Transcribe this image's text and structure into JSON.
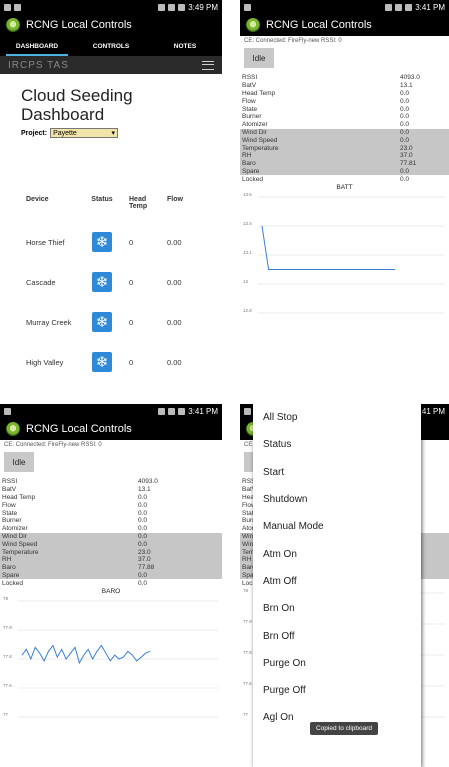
{
  "app": {
    "name": "RCNG Local Controls"
  },
  "screen1": {
    "status_time": "3:49 PM",
    "tabs": [
      {
        "label": "DASHBOARD"
      },
      {
        "label": "CONTROLS"
      },
      {
        "label": "NOTES"
      }
    ],
    "site_logo": "IRCPS TAS",
    "title_line1": "Cloud Seeding",
    "title_line2": "Dashboard",
    "project_label": "Project:",
    "project_value": "Payette",
    "columns": [
      "Device",
      "Status",
      "Head Temp",
      "Flow"
    ],
    "devices": [
      {
        "name": "Horse Thief",
        "head_temp": "0",
        "flow": "0.00"
      },
      {
        "name": "Cascade",
        "head_temp": "0",
        "flow": "0.00"
      },
      {
        "name": "Murray Creek",
        "head_temp": "0",
        "flow": "0.00"
      },
      {
        "name": "High Valley",
        "head_temp": "0",
        "flow": "0.00"
      }
    ],
    "status_icon": "snowflake-icon"
  },
  "controls": {
    "status_time": "3:41 PM",
    "connection": "CE: Connected: FireFly-new RSSI: 0",
    "idle_label": "Idle",
    "readings": [
      {
        "label": "RSSI",
        "value": "4093.0",
        "shaded": false
      },
      {
        "label": "BatV",
        "value": "13.1",
        "shaded": false
      },
      {
        "label": "Head Temp",
        "value": "0.0",
        "shaded": false
      },
      {
        "label": "Flow",
        "value": "0.0",
        "shaded": false
      },
      {
        "label": "State",
        "value": "0.0",
        "shaded": false
      },
      {
        "label": "Burner",
        "value": "0.0",
        "shaded": false
      },
      {
        "label": "Atomizer",
        "value": "0.0",
        "shaded": false
      },
      {
        "label": "Wind Dir",
        "value": "0.0",
        "shaded": true
      },
      {
        "label": "Wind Speed",
        "value": "0.0",
        "shaded": true
      },
      {
        "label": "Temperature",
        "value": "23.0",
        "shaded": true
      },
      {
        "label": "RH",
        "value": "37.0",
        "shaded": true
      },
      {
        "label": "Baro",
        "value": "77.81",
        "shaded": true
      },
      {
        "label": "Spare",
        "value": "0.0",
        "shaded": true
      },
      {
        "label": "Locked",
        "value": "0.0",
        "shaded": false
      }
    ],
    "baro_alt": "77.88"
  },
  "menu": {
    "items": [
      "All Stop",
      "Status",
      "Start",
      "Shutdown",
      "Manual Mode",
      "Atm On",
      "Atm Off",
      "Brn On",
      "Brn Off",
      "Purge On",
      "Purge Off",
      "Agl On"
    ],
    "toast": "Copied to clipboard"
  },
  "chart_data": [
    {
      "type": "line",
      "title": "BATT",
      "x": [
        0,
        1,
        2,
        3,
        4,
        5,
        6,
        7,
        8,
        9,
        10,
        11,
        12,
        13,
        14,
        15,
        16,
        17,
        18,
        19,
        20
      ],
      "series": [
        {
          "values": [
            13.4,
            13.1,
            13.1,
            13.1,
            13.1,
            13.1,
            13.1,
            13.1,
            13.1,
            13.1,
            13.1,
            13.1,
            13.1,
            13.1,
            13.1,
            13.1,
            13.1,
            13.1,
            13.1,
            13.1,
            13.1
          ]
        }
      ],
      "ylim": [
        12.8,
        13.6
      ],
      "yticks": [
        "13.6",
        "13.4",
        "13.1",
        "13",
        "12.8"
      ],
      "color": "#3a7fd4"
    },
    {
      "type": "line",
      "title": "BARO",
      "x": [
        0,
        1,
        2,
        3,
        4,
        5,
        6,
        7,
        8,
        9,
        10,
        11,
        12,
        13,
        14,
        15,
        16,
        17,
        18,
        19,
        20,
        21,
        22,
        23,
        24,
        25,
        26,
        27,
        28,
        29
      ],
      "series": [
        {
          "values": [
            77.82,
            77.85,
            77.8,
            77.86,
            77.83,
            77.79,
            77.84,
            77.87,
            77.81,
            77.85,
            77.8,
            77.83,
            77.86,
            77.78,
            77.82,
            77.85,
            77.8,
            77.84,
            77.87,
            77.83,
            77.79,
            77.82,
            77.8,
            77.81,
            77.84,
            77.82,
            77.79,
            77.81,
            77.83,
            77.84
          ]
        }
      ],
      "ylim": [
        77.5,
        78.1
      ],
      "yticks": [
        "78",
        "77.9",
        "77.8",
        "77.6",
        "77"
      ],
      "color": "#3a7fd4"
    }
  ],
  "colors": {
    "accent_tab": "#4cb2e0",
    "status_button": "#2e8ad8",
    "shade": "#c6c6c6"
  }
}
